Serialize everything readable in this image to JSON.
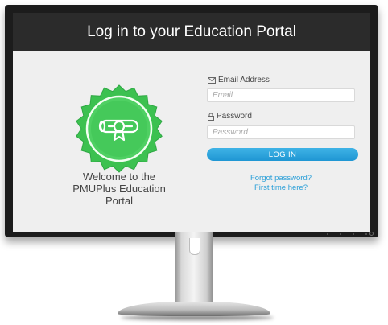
{
  "header": {
    "title": "Log in to your Education Portal"
  },
  "welcome": {
    "text": "Welcome to the\nPMUPlus Education\nPortal"
  },
  "form": {
    "email_label": "Email Address",
    "email_placeholder": "Email",
    "email_value": "",
    "password_label": "Password",
    "password_placeholder": "Password",
    "password_value": "",
    "login_label": "LOG IN"
  },
  "links": {
    "forgot_password": "Forgot password?",
    "first_time": "First time here?"
  },
  "icons": {
    "badge": "certificate-badge-icon",
    "email": "envelope-icon",
    "password": "lock-icon"
  },
  "colors": {
    "header_bg": "#2b2b2b",
    "badge_green": "#3cc150",
    "accent_blue": "#2a9fd8",
    "screen_bg": "#efefef"
  }
}
